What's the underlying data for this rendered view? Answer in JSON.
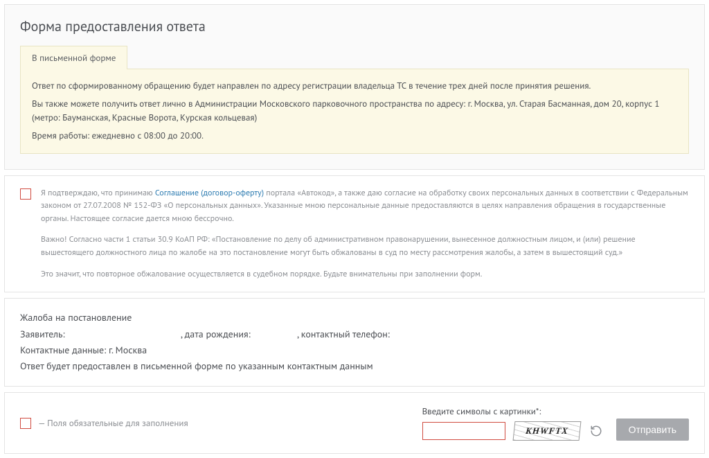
{
  "title": "Форма предоставления ответа",
  "tab_label": "В письменной форме",
  "notice": {
    "p1": "Ответ по сформированному обращению будет направлен по адресу регистрации владельца ТС в течение трех дней после принятия решения.",
    "p2": "Вы также можете получить ответ лично в Администрации Московского парковочного пространства по адресу: г. Москва, ул. Старая Басманная, дом 20, корпус 1 (метро: Бауманская, Красные Ворота, Курская кольцевая)",
    "p3": "Время работы: ежедневно с 08:00 до 20:00."
  },
  "agreement": {
    "prefix": "Я подтверждаю, что принимаю ",
    "link_text": "Соглашение (договор-оферту)",
    "suffix": " портала «Автокод», а также даю согласие на обработку своих персональных данных в соответствии с Федеральным законом от 27.07.2008 № 152-ФЗ «О персональных данных». Указанные мною персональные данные предоставляются в целях направления обращения в государственные органы. Настоящее согласие дается мною бессрочно.",
    "p2": "Важно! Согласно части 1 статьи 30.9 КоАП РФ: «Постановление по делу об административном правонарушении, вынесенное должностным лицом, и (или) решение вышестоящего должностного лица по жалобе на это постановление могут быть обжалованы в суд по месту рассмотрения жалобы, а затем в вышестоящий суд.»",
    "p3": "Это значит, что повторное обжалование осуществляется в судебном порядке. Будьте внимательны при заполнении форм."
  },
  "summary": {
    "heading": "Жалоба на постановление",
    "applicant_label": "Заявитель:",
    "applicant_value": "",
    "dob_label": ", дата рождения:",
    "dob_value": "",
    "phone_label": ", контактный телефон:",
    "phone_value": "",
    "contacts_label": "Контактные данные:",
    "contacts_value": "г. Москва",
    "delivery_note": "Ответ будет предоставлен в письменной форме по указанным контактным данным"
  },
  "required_legend": "— Поля обязательные для заполнения",
  "captcha": {
    "label": "Введите символы с картинки*:",
    "image_text": "KHWFTX",
    "input_value": ""
  },
  "submit_label": "Отправить"
}
